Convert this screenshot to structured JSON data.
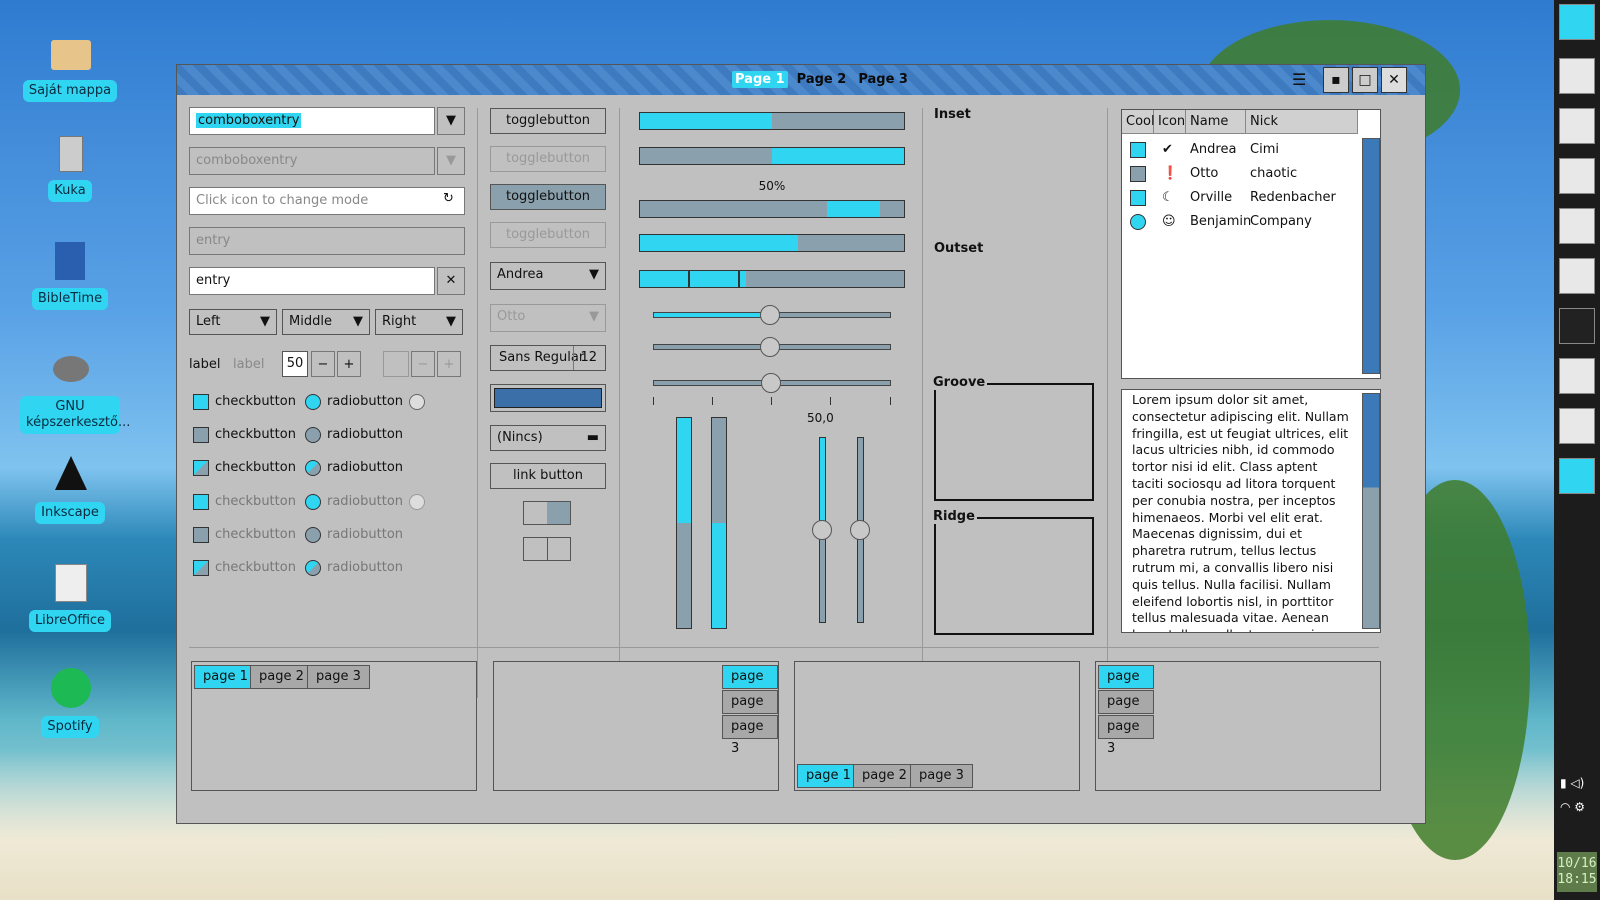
{
  "desktop": {
    "icons": [
      {
        "label": "Saját mappa",
        "icon": "home-folder-icon"
      },
      {
        "label": "Kuka",
        "icon": "trash-icon"
      },
      {
        "label": "BibleTime",
        "icon": "bibletime-icon"
      },
      {
        "label": "GNU képszerkesztő...",
        "icon": "gimp-icon"
      },
      {
        "label": "Inkscape",
        "icon": "inkscape-icon"
      },
      {
        "label": "LibreOffice",
        "icon": "libreoffice-icon"
      },
      {
        "label": "Spotify",
        "icon": "spotify-icon"
      }
    ]
  },
  "panel": {
    "clock_date": "10/16",
    "clock_time": "18:15"
  },
  "window": {
    "tabs": [
      "Page 1",
      "Page 2",
      "Page 3"
    ],
    "menu_glyph": "☰",
    "min_glyph": "▪",
    "max_glyph": "□",
    "close_glyph": "✕"
  },
  "col1": {
    "combo1": "comboboxentry",
    "combo2": "comboboxentry",
    "placeholder": "Click icon to change mode",
    "entry_disabled": "entry",
    "entry": "entry",
    "combos": [
      "Left",
      "Middle",
      "Right"
    ],
    "label1": "label",
    "label2": "label",
    "spin": "50",
    "checks": [
      "checkbutton",
      "checkbutton",
      "checkbutton",
      "checkbutton",
      "checkbutton",
      "checkbutton"
    ],
    "radios": [
      "radiobutton",
      "radiobutton",
      "radiobutton",
      "radiobutton",
      "radiobutton",
      "radiobutton"
    ]
  },
  "col2": {
    "toggles": [
      "togglebutton",
      "togglebutton",
      "togglebutton",
      "togglebutton"
    ],
    "combo_andrea": "Andrea",
    "combo_otto": "Otto",
    "font_name": "Sans Regular",
    "font_size": "12",
    "file_chooser": "(Nincs)",
    "link": "link button"
  },
  "col3": {
    "pct_label": "50%",
    "scale_value": "50,0",
    "progress": [
      0.5,
      0.5,
      0.2,
      0.6,
      0.4
    ]
  },
  "col4": {
    "inset": "Inset",
    "outset": "Outset",
    "groove": "Groove",
    "ridge": "Ridge"
  },
  "tree": {
    "headers": [
      "Cool",
      "Icon",
      "Name",
      "Nick"
    ],
    "rows": [
      {
        "cool": "cyan",
        "icon": "check-circle-icon",
        "name": "Andrea",
        "nick": "Cimi"
      },
      {
        "cool": "gray",
        "icon": "warning-icon",
        "name": "Otto",
        "nick": "chaotic"
      },
      {
        "cool": "cyan",
        "icon": "moon-icon",
        "name": "Orville",
        "nick": "Redenbacher"
      },
      {
        "cool": "cyanround",
        "icon": "tux-icon",
        "name": "Benjamin",
        "nick": "Company"
      }
    ]
  },
  "text": {
    "body": "Lorem ipsum dolor sit amet, consectetur adipiscing elit. Nullam fringilla, est ut feugiat ultrices, elit lacus ultricies nibh, id commodo tortor nisi id elit. Class aptent taciti sociosqu ad litora torquent per conubia nostra, per inceptos himenaeos. Morbi vel elit erat. Maecenas dignissim, dui et pharetra rutrum, tellus lectus rutrum mi, a convallis libero nisi quis tellus. Nulla facilisi. Nullam eleifend lobortis nisl, in porttitor tellus malesuada vitae. Aenean lacus tellus, pellentesque quis"
  },
  "notebooks": {
    "tabs": [
      "page 1",
      "page 2",
      "page 3"
    ]
  },
  "colors": {
    "accent": "#30d6f1",
    "slate": "#8aa0ac",
    "window_bg": "#c0c0c0"
  }
}
